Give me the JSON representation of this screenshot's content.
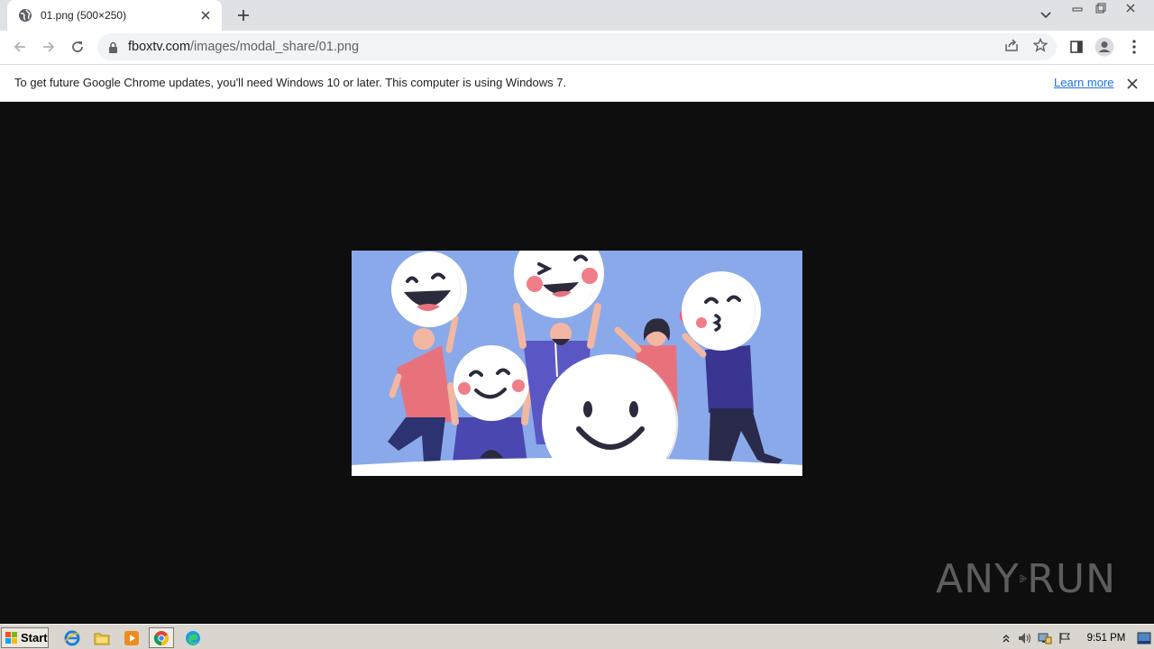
{
  "browser": {
    "tab": {
      "title": "01.png (500×250)"
    },
    "address_bar": {
      "domain": "fboxtv.com",
      "path": "/images/modal_share/01.png"
    },
    "infobar": {
      "message": "To get future Google Chrome updates, you'll need Windows 10 or later. This computer is using Windows 7.",
      "link_label": "Learn more"
    }
  },
  "watermark": {
    "text_left": "ANY",
    "text_right": "RUN"
  },
  "taskbar": {
    "start_label": "Start",
    "clock": "9:51 PM",
    "apps": [
      "internet-explorer-icon",
      "file-explorer-icon",
      "media-player-icon",
      "chrome-icon",
      "edge-icon"
    ]
  },
  "colors": {
    "image_background": "#8aa9ea",
    "viewer_background": "#0e0e0e",
    "link": "#1a73e8",
    "tabstrip": "#dee1e6"
  }
}
